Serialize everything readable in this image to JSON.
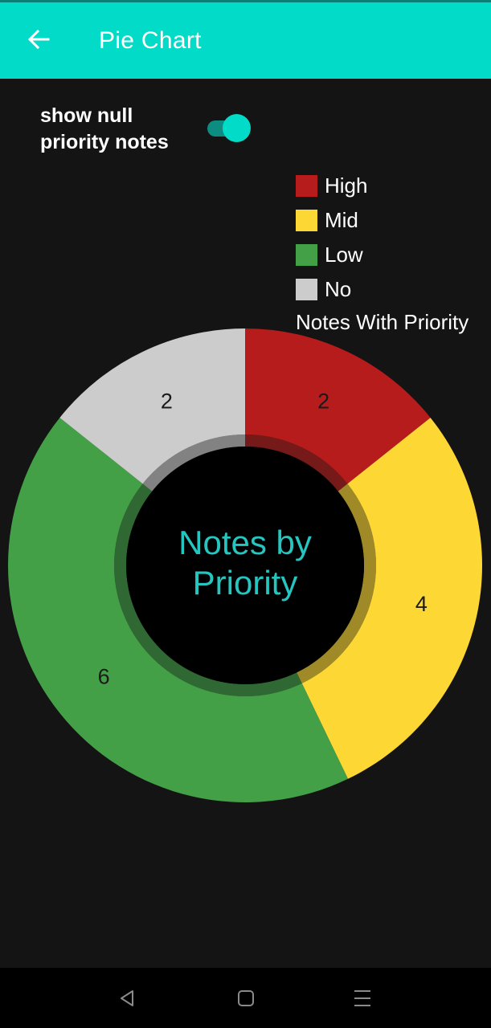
{
  "app_bar": {
    "title": "Pie Chart",
    "background": "#02dbc7",
    "back_icon": "arrow-left-icon"
  },
  "settings": {
    "null_toggle_label": "show null priority notes",
    "null_toggle_on": true
  },
  "legend": {
    "title": "Notes With Priority",
    "items": [
      {
        "label": "High",
        "color": "#b71c1c"
      },
      {
        "label": "Mid",
        "color": "#fdd835"
      },
      {
        "label": "Low",
        "color": "#43a047"
      },
      {
        "label": "No",
        "color": "#cccccc"
      }
    ]
  },
  "chart_data": {
    "type": "pie",
    "style": "donut",
    "center_text": "Notes by Priority",
    "center_text_color": "#26c6c0",
    "start_angle_deg": 0,
    "categories": [
      "High",
      "Mid",
      "Low",
      "No"
    ],
    "values": [
      2,
      4,
      6,
      2
    ],
    "colors": [
      "#b71c1c",
      "#fdd835",
      "#43a047",
      "#cccccc"
    ],
    "data_labels": [
      "2",
      "4",
      "6",
      "2"
    ],
    "legend_placement": "top-right"
  },
  "nav_bar": {
    "icons": [
      "back-triangle-icon",
      "home-square-icon",
      "menu-lines-icon"
    ]
  }
}
